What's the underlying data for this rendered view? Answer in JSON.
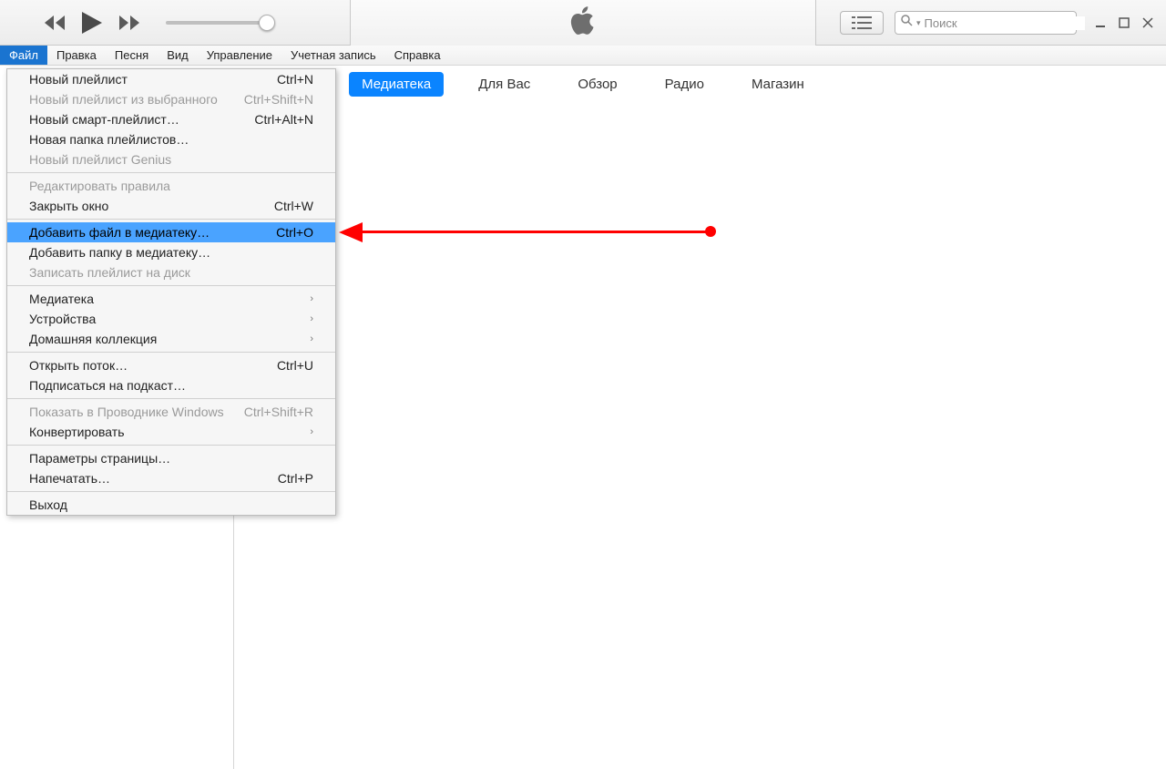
{
  "search": {
    "placeholder": "Поиск"
  },
  "menubar": [
    "Файл",
    "Правка",
    "Песня",
    "Вид",
    "Управление",
    "Учетная запись",
    "Справка"
  ],
  "tabs": [
    "Медиатека",
    "Для Вас",
    "Обзор",
    "Радио",
    "Магазин"
  ],
  "fileMenu": {
    "groups": [
      [
        {
          "label": "Новый плейлист",
          "shortcut": "Ctrl+N",
          "disabled": false
        },
        {
          "label": "Новый плейлист из выбранного",
          "shortcut": "Ctrl+Shift+N",
          "disabled": true
        },
        {
          "label": "Новый смарт-плейлист…",
          "shortcut": "Ctrl+Alt+N",
          "disabled": false
        },
        {
          "label": "Новая папка плейлистов…",
          "shortcut": "",
          "disabled": false
        },
        {
          "label": "Новый плейлист Genius",
          "shortcut": "",
          "disabled": true
        }
      ],
      [
        {
          "label": "Редактировать правила",
          "shortcut": "",
          "disabled": true
        },
        {
          "label": "Закрыть окно",
          "shortcut": "Ctrl+W",
          "disabled": false
        }
      ],
      [
        {
          "label": "Добавить файл в медиатеку…",
          "shortcut": "Ctrl+O",
          "disabled": false,
          "highlight": true
        },
        {
          "label": "Добавить папку в медиатеку…",
          "shortcut": "",
          "disabled": false
        },
        {
          "label": "Записать плейлист на диск",
          "shortcut": "",
          "disabled": true
        }
      ],
      [
        {
          "label": "Медиатека",
          "shortcut": "",
          "disabled": false,
          "submenu": true
        },
        {
          "label": "Устройства",
          "shortcut": "",
          "disabled": false,
          "submenu": true
        },
        {
          "label": "Домашняя коллекция",
          "shortcut": "",
          "disabled": false,
          "submenu": true
        }
      ],
      [
        {
          "label": "Открыть поток…",
          "shortcut": "Ctrl+U",
          "disabled": false
        },
        {
          "label": "Подписаться на подкаст…",
          "shortcut": "",
          "disabled": false
        }
      ],
      [
        {
          "label": "Показать в Проводнике Windows",
          "shortcut": "Ctrl+Shift+R",
          "disabled": true
        },
        {
          "label": "Конвертировать",
          "shortcut": "",
          "disabled": false,
          "submenu": true
        }
      ],
      [
        {
          "label": "Параметры страницы…",
          "shortcut": "",
          "disabled": false
        },
        {
          "label": "Напечатать…",
          "shortcut": "Ctrl+P",
          "disabled": false
        }
      ],
      [
        {
          "label": "Выход",
          "shortcut": "",
          "disabled": false
        }
      ]
    ]
  }
}
